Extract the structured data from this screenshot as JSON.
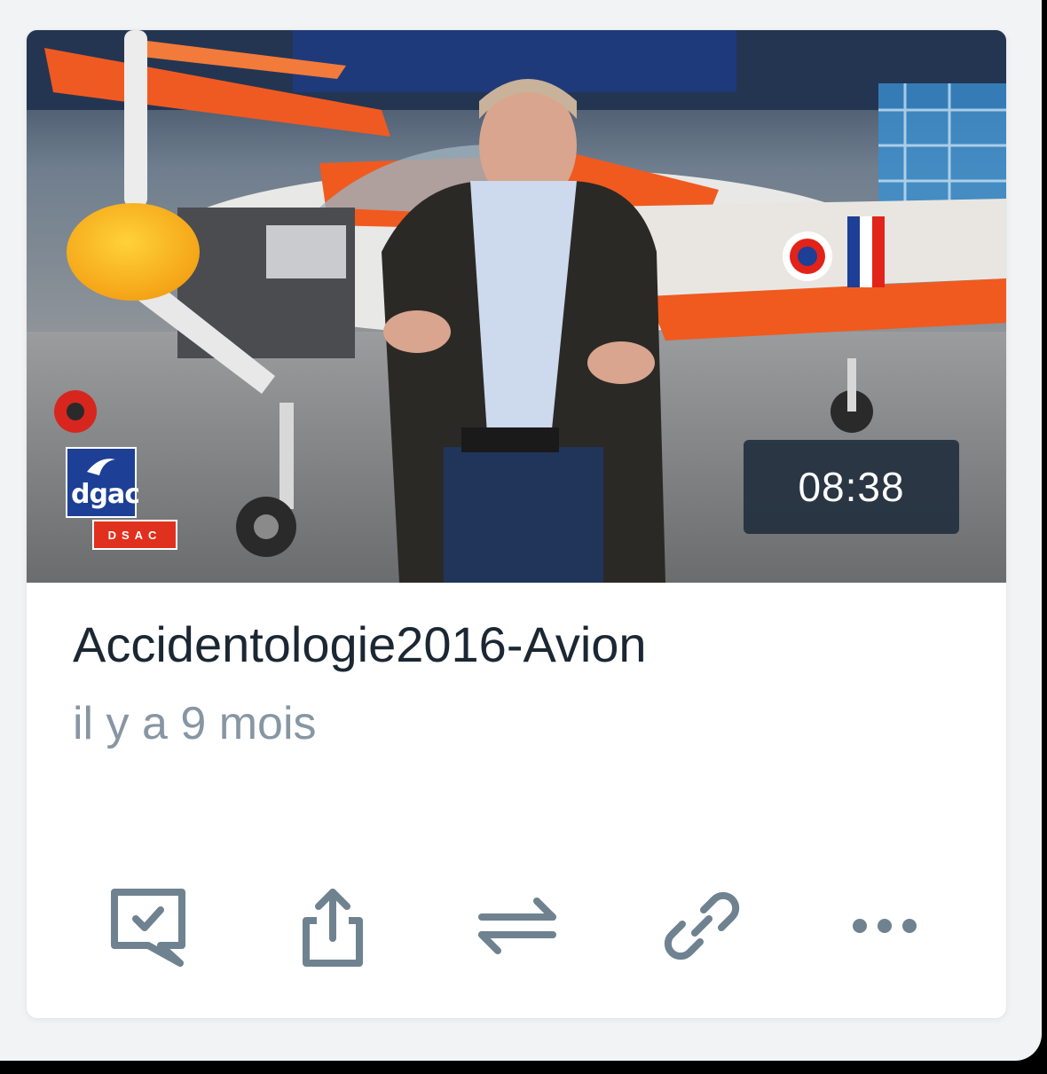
{
  "video": {
    "duration": "08:38",
    "title": "Accidentologie2016-Avion",
    "age": "il y a 9 mois",
    "logo": {
      "brand": "dgac",
      "sub": "DSAC"
    }
  },
  "actions": [
    {
      "icon": "comment-check-icon",
      "name": "review"
    },
    {
      "icon": "share-upload-icon",
      "name": "share"
    },
    {
      "icon": "swap-arrows-icon",
      "name": "replace"
    },
    {
      "icon": "link-icon",
      "name": "copy-link"
    },
    {
      "icon": "more-dots-icon",
      "name": "more"
    }
  ],
  "colors": {
    "icon": "#6f8290",
    "title": "#1b2733",
    "subtitle": "#8796a3",
    "duration_bg": "#23303e",
    "frame_bg": "#f2f3f4"
  }
}
